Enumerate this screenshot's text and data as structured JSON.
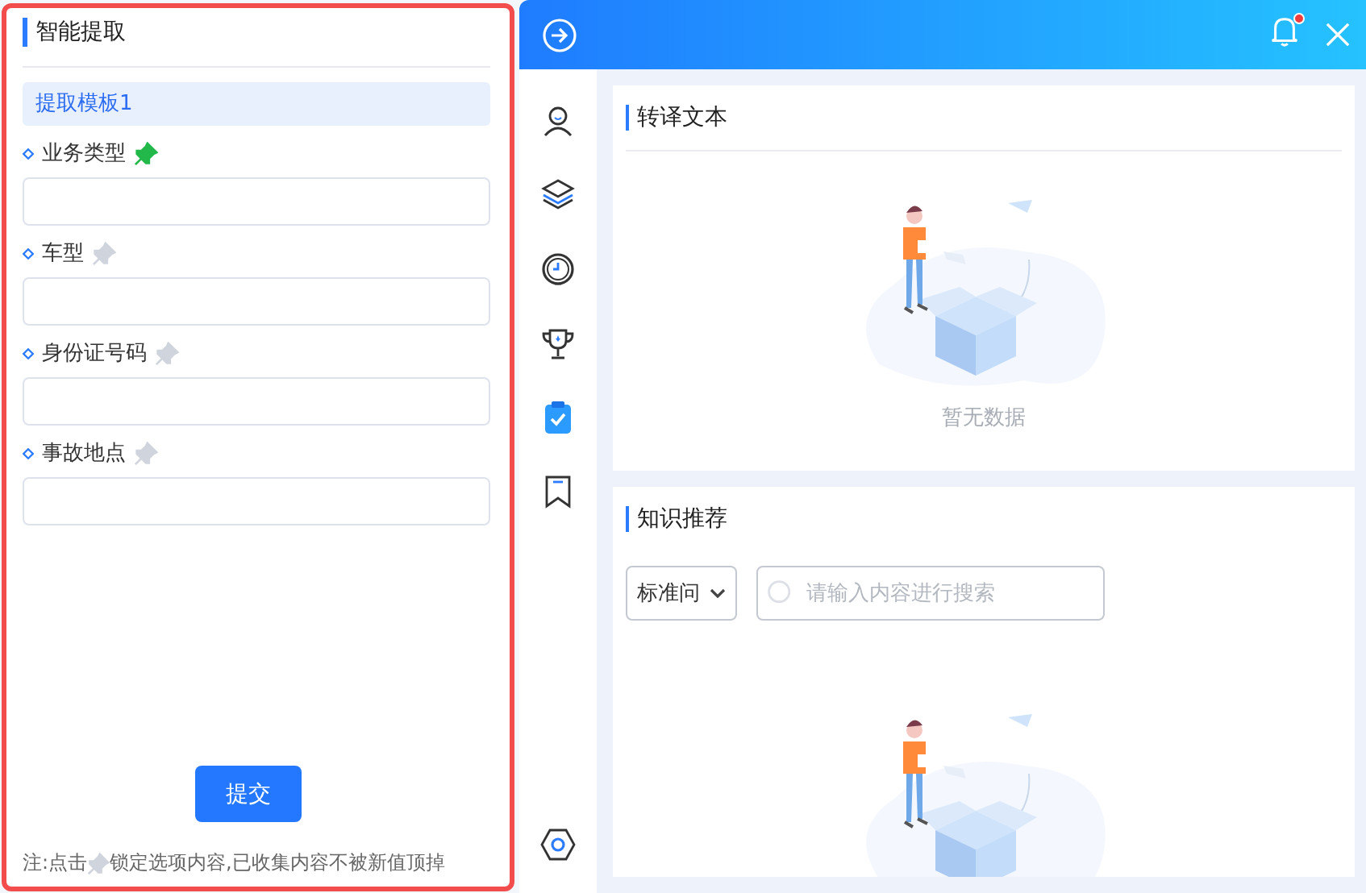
{
  "left_panel": {
    "title": "智能提取",
    "templates": [
      {
        "label": "提取模板1",
        "selected": true
      }
    ],
    "fields": [
      {
        "label": "业务类型",
        "pinned": true
      },
      {
        "label": "车型",
        "pinned": false
      },
      {
        "label": "身份证号码",
        "pinned": false
      },
      {
        "label": "事故地点",
        "pinned": false
      }
    ],
    "submit": "提交",
    "note_before": "注:点击",
    "note_after": "锁定选项内容,已收集内容不被新值顶掉"
  },
  "header": {
    "has_unread": true
  },
  "sidebar": {
    "items": [
      {
        "kind": "user",
        "selected": false
      },
      {
        "kind": "layers",
        "selected": false
      },
      {
        "kind": "support",
        "selected": false
      },
      {
        "kind": "trophy",
        "selected": false
      },
      {
        "kind": "clipboard",
        "selected": true
      },
      {
        "kind": "bookmark",
        "selected": false
      },
      {
        "kind": "settings",
        "selected": false
      }
    ]
  },
  "transcript": {
    "title": "转译文本",
    "empty_text": "暂无数据"
  },
  "knowledge": {
    "title": "知识推荐",
    "filter": "标准问",
    "search": {
      "placeholder": "请输入内容进行搜索"
    }
  }
}
